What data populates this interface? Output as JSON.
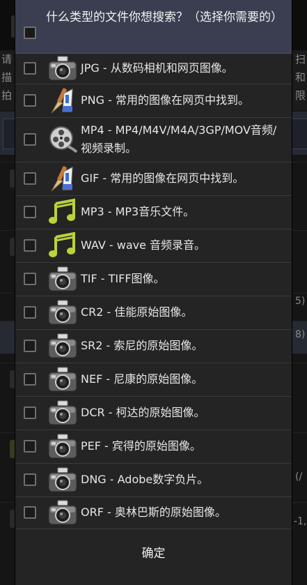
{
  "background": {
    "note_line1_left": "请",
    "note_line1_right": "扫",
    "note_line2_left": "描",
    "note_line2_right": "和",
    "note_line3_left": "拍",
    "note_line3_right": "限",
    "side_rows": [
      "5)",
      "8)",
      "(/",
      "-1,"
    ]
  },
  "dialog": {
    "title": "什么类型的文件你想搜索？（选择你需要的）",
    "ok_label": "确定",
    "items": [
      {
        "icon": "camera-icon",
        "label": "JPG - 从数码相机和网页图像。"
      },
      {
        "icon": "paint-brush-icon",
        "label": "PNG - 常用的图像在网页中找到。"
      },
      {
        "icon": "film-reel-icon",
        "label": "MP4 - MP4/M4V/M4A/3GP/MOV音频/视频录制。"
      },
      {
        "icon": "paint-brush-icon",
        "label": "GIF - 常用的图像在网页中找到。"
      },
      {
        "icon": "music-note-icon",
        "label": "MP3 - MP3音乐文件。"
      },
      {
        "icon": "music-note-icon",
        "label": "WAV - wave 音频录音。"
      },
      {
        "icon": "camera-icon",
        "label": "TIF - TIFF图像。"
      },
      {
        "icon": "camera-icon",
        "label": "CR2 - 佳能原始图像。"
      },
      {
        "icon": "camera-icon",
        "label": "SR2 - 索尼的原始图像。"
      },
      {
        "icon": "camera-icon",
        "label": "NEF - 尼康的原始图像。"
      },
      {
        "icon": "camera-icon",
        "label": "DCR - 柯达的原始图像。"
      },
      {
        "icon": "camera-icon",
        "label": "PEF - 宾得的原始图像。"
      },
      {
        "icon": "camera-icon",
        "label": "DNG - Adobe数字负片。"
      },
      {
        "icon": "camera-icon",
        "label": "ORF - 奥林巴斯的原始图像。"
      }
    ]
  }
}
